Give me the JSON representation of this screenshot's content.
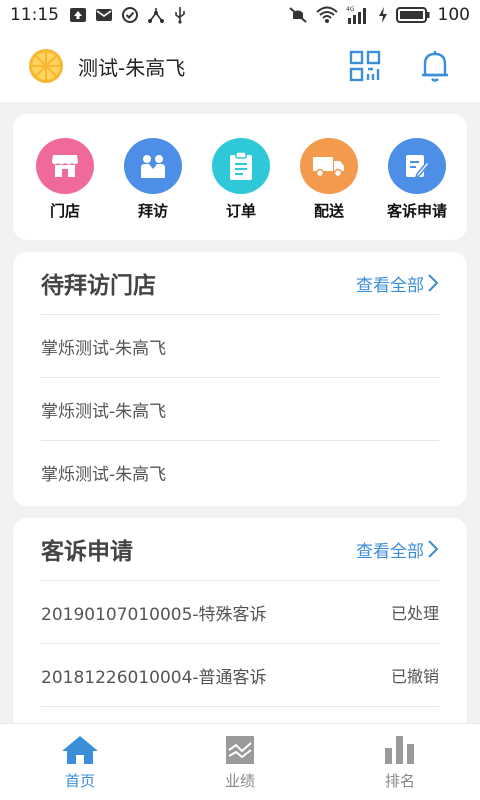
{
  "status_bar": {
    "time": "11:15",
    "network": "4G",
    "battery": "100",
    "icons": [
      "upload-icon",
      "mail-icon",
      "check-circle-icon",
      "share-icon",
      "usb-icon",
      "mute-icon",
      "wifi-icon",
      "signal-icon",
      "charging-icon",
      "battery-icon"
    ]
  },
  "header": {
    "title": "测试-朱高飞",
    "logo_icon": "orange-logo-icon",
    "actions": [
      "qr-scan-icon",
      "bell-icon"
    ]
  },
  "quick_actions": [
    {
      "label": "门店",
      "icon": "store-icon",
      "color": "#ef6a9a"
    },
    {
      "label": "拜访",
      "icon": "visit-icon",
      "color": "#4d8fe6"
    },
    {
      "label": "订单",
      "icon": "order-clipboard-icon",
      "color": "#2fc8d8"
    },
    {
      "label": "配送",
      "icon": "delivery-truck-icon",
      "color": "#f49a4d"
    },
    {
      "label": "客诉申请",
      "icon": "complaint-edit-icon",
      "color": "#4d8fe6"
    }
  ],
  "pending_visits": {
    "title": "待拜访门店",
    "more": "查看全部",
    "items": [
      "掌烁测试-朱高飞",
      "掌烁测试-朱高飞",
      "掌烁测试-朱高飞"
    ]
  },
  "complaints": {
    "title": "客诉申请",
    "more": "查看全部",
    "items": [
      {
        "text": "20190107010005-特殊客诉",
        "status": "已处理"
      },
      {
        "text": "20181226010004-普通客诉",
        "status": "已撤销"
      }
    ]
  },
  "tabbar": {
    "active_color": "#3b8ed8",
    "tabs": [
      {
        "label": "首页",
        "icon": "home-icon",
        "active": true
      },
      {
        "label": "业绩",
        "icon": "performance-chart-icon",
        "active": false
      },
      {
        "label": "排名",
        "icon": "ranking-bars-icon",
        "active": false
      }
    ]
  }
}
